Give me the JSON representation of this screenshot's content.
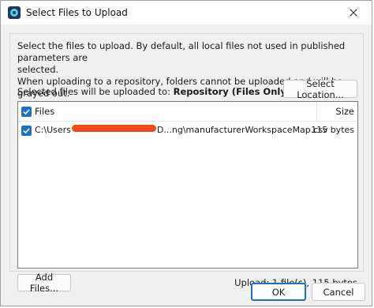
{
  "window": {
    "title": "Select Files to Upload",
    "close_symbol": "✕"
  },
  "description": {
    "line1": "Select the files to upload. By default, all local files not used in published parameters are",
    "line2": "selected.",
    "line3": "When uploading to a repository, folders cannot be uploaded and will be grayed out."
  },
  "destination": {
    "label": "Selected files will be uploaded to:",
    "value": "Repository (Files Only)",
    "select_location_button": "Select Location..."
  },
  "file_list": {
    "columns": {
      "files": "Files",
      "size": "Size"
    },
    "header_checked": true,
    "rows": [
      {
        "checked": true,
        "path_prefix": "C:\\Users",
        "path_suffix": "D...ng\\manufacturerWorkspaceMap.csv",
        "size": "115 bytes"
      }
    ]
  },
  "footer": {
    "add_files_button": "Add Files...",
    "upload_summary": "Upload: 1 file(s), 115 bytes"
  },
  "dialog_buttons": {
    "ok": "OK",
    "cancel": "Cancel"
  },
  "colors": {
    "accent": "#1f6fc5",
    "redaction": "#f04a1b"
  }
}
